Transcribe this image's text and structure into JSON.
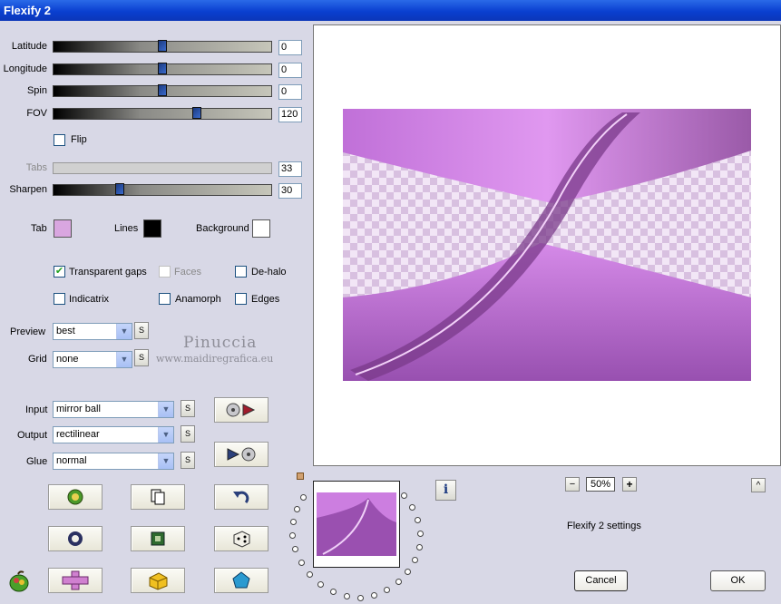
{
  "window": {
    "title": "Flexify 2"
  },
  "sliders": [
    {
      "label": "Latitude",
      "value": "0",
      "position": 0.5
    },
    {
      "label": "Longitude",
      "value": "0",
      "position": 0.5
    },
    {
      "label": "Spin",
      "value": "0",
      "position": 0.5
    },
    {
      "label": "FOV",
      "value": "120",
      "position": 0.66
    },
    {
      "label": "Tabs",
      "value": "33",
      "position": 0.33,
      "disabled": true
    },
    {
      "label": "Sharpen",
      "value": "30",
      "position": 0.3
    }
  ],
  "flip": {
    "label": "Flip",
    "checked": false
  },
  "colors": {
    "tab": {
      "label": "Tab",
      "color": "#d9a6e0"
    },
    "lines": {
      "label": "Lines",
      "color": "#000000"
    },
    "background": {
      "label": "Background",
      "color": "#ffffff"
    }
  },
  "options": {
    "transparent_gaps": {
      "label": "Transparent gaps",
      "checked": true
    },
    "faces": {
      "label": "Faces",
      "checked": false,
      "disabled": true
    },
    "de_halo": {
      "label": "De-halo",
      "checked": false
    },
    "indicatrix": {
      "label": "Indicatrix",
      "checked": false
    },
    "anamorph": {
      "label": "Anamorph",
      "checked": false
    },
    "edges": {
      "label": "Edges",
      "checked": false
    }
  },
  "preview": {
    "label": "Preview",
    "value": "best"
  },
  "grid": {
    "label": "Grid",
    "value": "none"
  },
  "input": {
    "label": "Input",
    "value": "mirror ball"
  },
  "output": {
    "label": "Output",
    "value": "rectilinear"
  },
  "glue": {
    "label": "Glue",
    "value": "normal"
  },
  "s_label": "S",
  "watermark": {
    "name": "Pinuccia",
    "url": "www.maidiregrafica.eu"
  },
  "zoom": {
    "minus": "−",
    "value": "50%",
    "plus": "+"
  },
  "settings_text": "Flexify 2 settings",
  "info_label": "i",
  "up_label": "^",
  "buttons": {
    "cancel": "Cancel",
    "ok": "OK"
  }
}
